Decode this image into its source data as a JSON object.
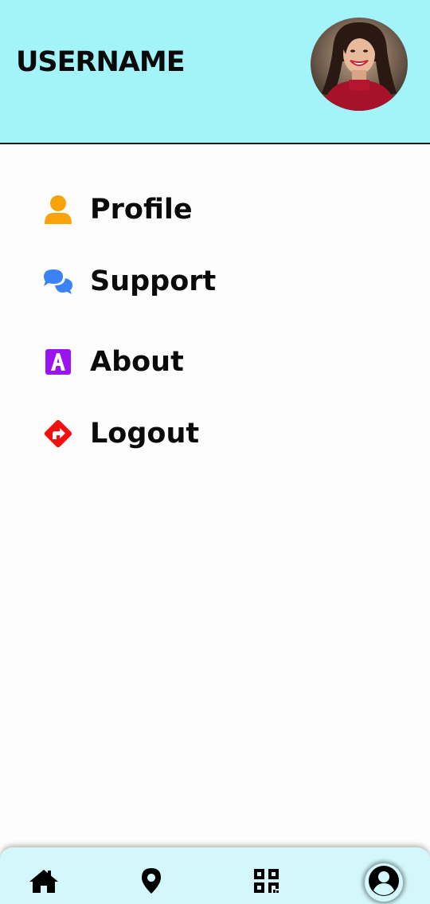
{
  "header": {
    "username": "USERNAME",
    "background_color": "#a2f4f8"
  },
  "menu": {
    "items": [
      {
        "label": "Profile",
        "icon": "user-icon",
        "icon_color": "#f9a30a"
      },
      {
        "label": "Support",
        "icon": "chat-bubbles-icon",
        "icon_color": "#3b82f6"
      },
      {
        "label": "About",
        "icon": "about-badge-icon",
        "icon_color": "#9b13f0"
      },
      {
        "label": "Logout",
        "icon": "logout-diamond-icon",
        "icon_color": "#f50e0e"
      }
    ]
  },
  "bottom_nav": {
    "items": [
      {
        "icon": "home-icon"
      },
      {
        "icon": "map-pin-icon"
      },
      {
        "icon": "qr-code-icon"
      },
      {
        "icon": "account-circle-icon",
        "active": true
      }
    ],
    "background_color": "#d3f7fb"
  }
}
